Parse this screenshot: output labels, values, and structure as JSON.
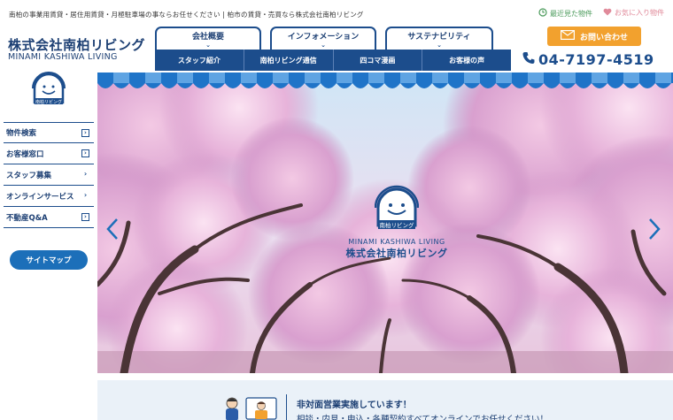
{
  "header": {
    "tagline": "南柏の事業用賃貸・居住用賃貸・月極駐車場の事ならお任せください | 柏市の賃貸・売買なら株式会社南柏リビング",
    "logo_title": "株式会社南柏リビング",
    "logo_sub": "MINAMI KASHIWA LIVING",
    "recent_label": "最近見た物件",
    "favorite_label": "お気に入り物件",
    "contact_label": "お問い合わせ",
    "phone": "04-7197-4519"
  },
  "nav": {
    "top": [
      {
        "label": "会社概要"
      },
      {
        "label": "インフォメーション"
      },
      {
        "label": "サステナビリティ"
      }
    ],
    "sub": [
      {
        "label": "スタッフ紹介"
      },
      {
        "label": "南柏リビング通信"
      },
      {
        "label": "四コマ漫画"
      },
      {
        "label": "お客様の声"
      }
    ]
  },
  "sidebar": {
    "logo_text": "南柏リビング",
    "items": [
      {
        "label": "物件検索",
        "arrow": "›"
      },
      {
        "label": "お客様窓口",
        "arrow": "›"
      },
      {
        "label": "スタッフ募集",
        "arrow": "›"
      },
      {
        "label": "オンラインサービス",
        "arrow": "›"
      },
      {
        "label": "不動産Q&A",
        "arrow": "›"
      }
    ],
    "sitemap_label": "サイトマップ"
  },
  "hero": {
    "logo_en": "MINAMI KASHIWA LIVING",
    "logo_jp": "株式会社南柏リビング",
    "logo_badge": "南柏リビング"
  },
  "notice": {
    "title": "非対面営業実施しています！",
    "text": "相談・内見・申込・各種契約すべてオンラインでお任せください！"
  },
  "colors": {
    "navy": "#1c4d8c",
    "orange": "#f2a12e",
    "scallop": "#1f74c8",
    "notice_bg": "#eaf1f8"
  }
}
